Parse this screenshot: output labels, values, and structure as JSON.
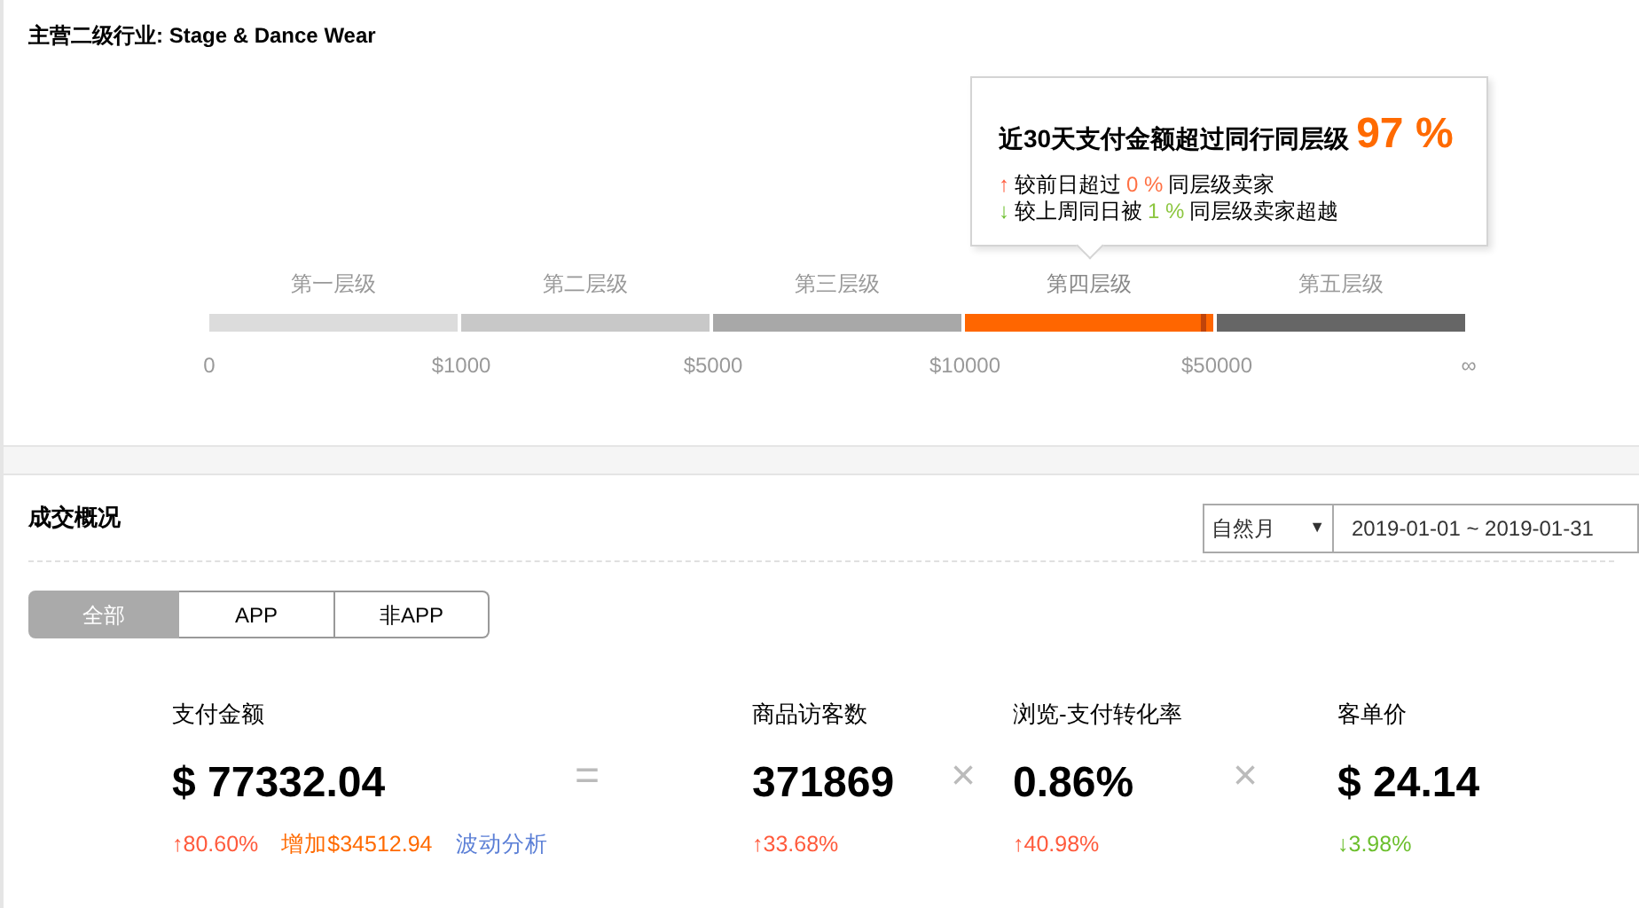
{
  "industry": {
    "label": "主营二级行业: Stage & Dance Wear"
  },
  "tooltip": {
    "headline": "近30天支付金额超过同行同层级",
    "percent": "97 %",
    "lines": [
      {
        "arrow": "↑",
        "kind": "up",
        "prefix": "较前日超过",
        "value": "0 %",
        "suffix": "同层级卖家"
      },
      {
        "arrow": "↓",
        "kind": "down",
        "prefix": "较上周同日被",
        "value": "1 %",
        "suffix": "同层级卖家超越"
      }
    ]
  },
  "tiers": [
    {
      "label": "第一层级",
      "selected": false
    },
    {
      "label": "第二层级",
      "selected": false
    },
    {
      "label": "第三层级",
      "selected": false
    },
    {
      "label": "第四层级",
      "selected": true
    },
    {
      "label": "第五层级",
      "selected": false
    }
  ],
  "tier_marker": {
    "level": 0.97
  },
  "ticks": [
    "0",
    "$1000",
    "$5000",
    "$10000",
    "$50000",
    "∞"
  ],
  "overview": {
    "title": "成交概况",
    "period": {
      "value": "自然月",
      "caret": "▼"
    },
    "date_range": "2019-01-01 ~ 2019-01-31",
    "tabs": [
      {
        "label": "全部",
        "selected": true
      },
      {
        "label": "APP",
        "selected": false
      },
      {
        "label": "非APP",
        "selected": false
      }
    ],
    "items": [
      {
        "kind": "metric",
        "label": "支付金额",
        "value": "$ 77332.04",
        "change": {
          "arrow": "↑",
          "kind": "up",
          "text": "80.60%"
        },
        "increase": "增加$34512.94",
        "link": "波动分析"
      },
      {
        "kind": "operator",
        "symbol": "="
      },
      {
        "kind": "metric",
        "label": "商品访客数",
        "value": "371869",
        "change": {
          "arrow": "↑",
          "kind": "up",
          "text": "33.68%"
        }
      },
      {
        "kind": "operator",
        "symbol": "×"
      },
      {
        "kind": "metric",
        "label": "浏览-支付转化率",
        "value": "0.86%",
        "change": {
          "arrow": "↑",
          "kind": "up",
          "text": "40.98%"
        }
      },
      {
        "kind": "operator",
        "symbol": "×"
      },
      {
        "kind": "metric",
        "label": "客单价",
        "value": "$ 24.14",
        "change": {
          "arrow": "↓",
          "kind": "down",
          "text": "3.98%"
        }
      }
    ]
  }
}
